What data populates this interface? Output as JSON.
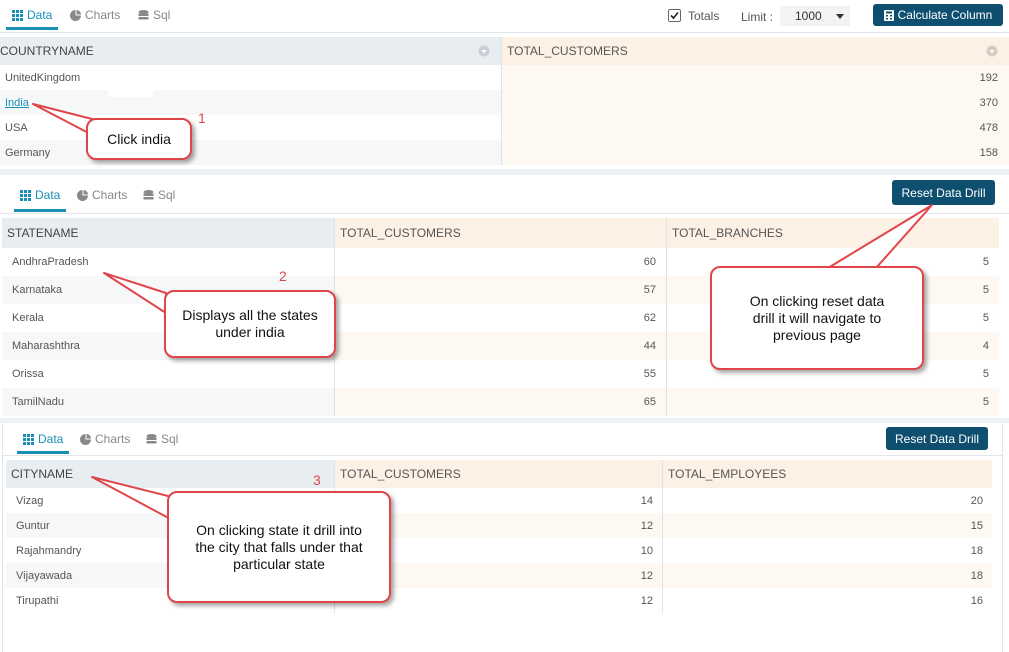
{
  "panel1": {
    "tabs": [
      "Data",
      "Charts",
      "Sql"
    ],
    "totals_label": "Totals",
    "limit_label": "Limit :",
    "limit_value": "1000",
    "calc_button": "Calculate Column",
    "columns": [
      "COUNTRYNAME",
      "TOTAL_CUSTOMERS"
    ],
    "rows": [
      {
        "name": "UnitedKingdom",
        "value": "192"
      },
      {
        "name": "India",
        "value": "370"
      },
      {
        "name": "USA",
        "value": "478"
      },
      {
        "name": "Germany",
        "value": "158"
      }
    ]
  },
  "panel2": {
    "tabs": [
      "Data",
      "Charts",
      "Sql"
    ],
    "reset_button": "Reset Data Drill",
    "columns": [
      "STATENAME",
      "TOTAL_CUSTOMERS",
      "TOTAL_BRANCHES"
    ],
    "rows": [
      {
        "name": "AndhraPradesh",
        "customers": "60",
        "branches": "5"
      },
      {
        "name": "Karnataka",
        "customers": "57",
        "branches": "5"
      },
      {
        "name": "Kerala",
        "customers": "62",
        "branches": "5"
      },
      {
        "name": "Maharashthra",
        "customers": "44",
        "branches": "4"
      },
      {
        "name": "Orissa",
        "customers": "55",
        "branches": "5"
      },
      {
        "name": "TamilNadu",
        "customers": "65",
        "branches": "5"
      }
    ]
  },
  "panel3": {
    "tabs": [
      "Data",
      "Charts",
      "Sql"
    ],
    "reset_button": "Reset Data Drill",
    "columns": [
      "CITYNAME",
      "TOTAL_CUSTOMERS",
      "TOTAL_EMPLOYEES"
    ],
    "rows": [
      {
        "name": "Vizag",
        "customers": "14",
        "employees": "20"
      },
      {
        "name": "Guntur",
        "customers": "12",
        "employees": "15"
      },
      {
        "name": "Rajahmandry",
        "customers": "10",
        "employees": "18"
      },
      {
        "name": "Vijayawada",
        "customers": "12",
        "employees": "18"
      },
      {
        "name": "Tirupathi",
        "customers": "12",
        "employees": "16"
      }
    ]
  },
  "annotations": {
    "step1": "1",
    "step1_text": "Click india",
    "step2": "2",
    "step2_text": "Displays all the states under india",
    "step3": "3",
    "step3_text": "On clicking state it drill into the city that falls under that particular state",
    "reset_text": "On clicking reset data drill it will navigate to previous page"
  },
  "colors": {
    "accent": "#1a8fb5",
    "button": "#0e4f70",
    "callout_border": "#e0454a"
  }
}
